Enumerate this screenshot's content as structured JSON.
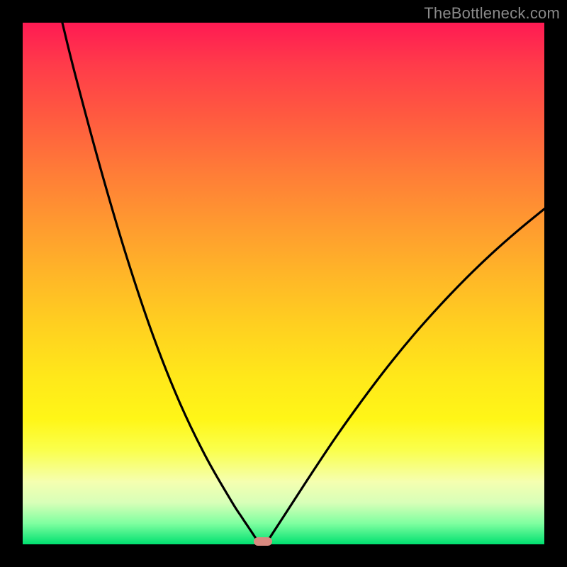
{
  "watermark": "TheBottleneck.com",
  "chart_data": {
    "type": "line",
    "title": "",
    "xlabel": "",
    "ylabel": "",
    "xlim": [
      0,
      100
    ],
    "ylim": [
      0,
      100
    ],
    "grid": false,
    "legend": false,
    "series": [
      {
        "name": "left-curve",
        "x": [
          7.6,
          10,
          15,
          20,
          25,
          30,
          35,
          40,
          42,
          43,
          44,
          44.8
        ],
        "y": [
          100,
          90.3,
          71.8,
          54.9,
          40.0,
          27.4,
          17.0,
          8.3,
          5.2,
          3.7,
          2.2,
          1.0
        ]
      },
      {
        "name": "right-curve",
        "x": [
          47.2,
          50,
          55,
          60,
          65,
          70,
          75,
          80,
          85,
          90,
          95,
          100
        ],
        "y": [
          1.0,
          5.3,
          13.0,
          20.5,
          27.5,
          34.1,
          40.2,
          45.8,
          51.0,
          55.8,
          60.2,
          64.3
        ]
      }
    ],
    "markers": [
      {
        "name": "min-point",
        "x": 46,
        "y": 0.5,
        "color": "#d98a80"
      }
    ],
    "background_gradient": {
      "top": "#ff1a53",
      "bottom": "#00e070"
    }
  }
}
